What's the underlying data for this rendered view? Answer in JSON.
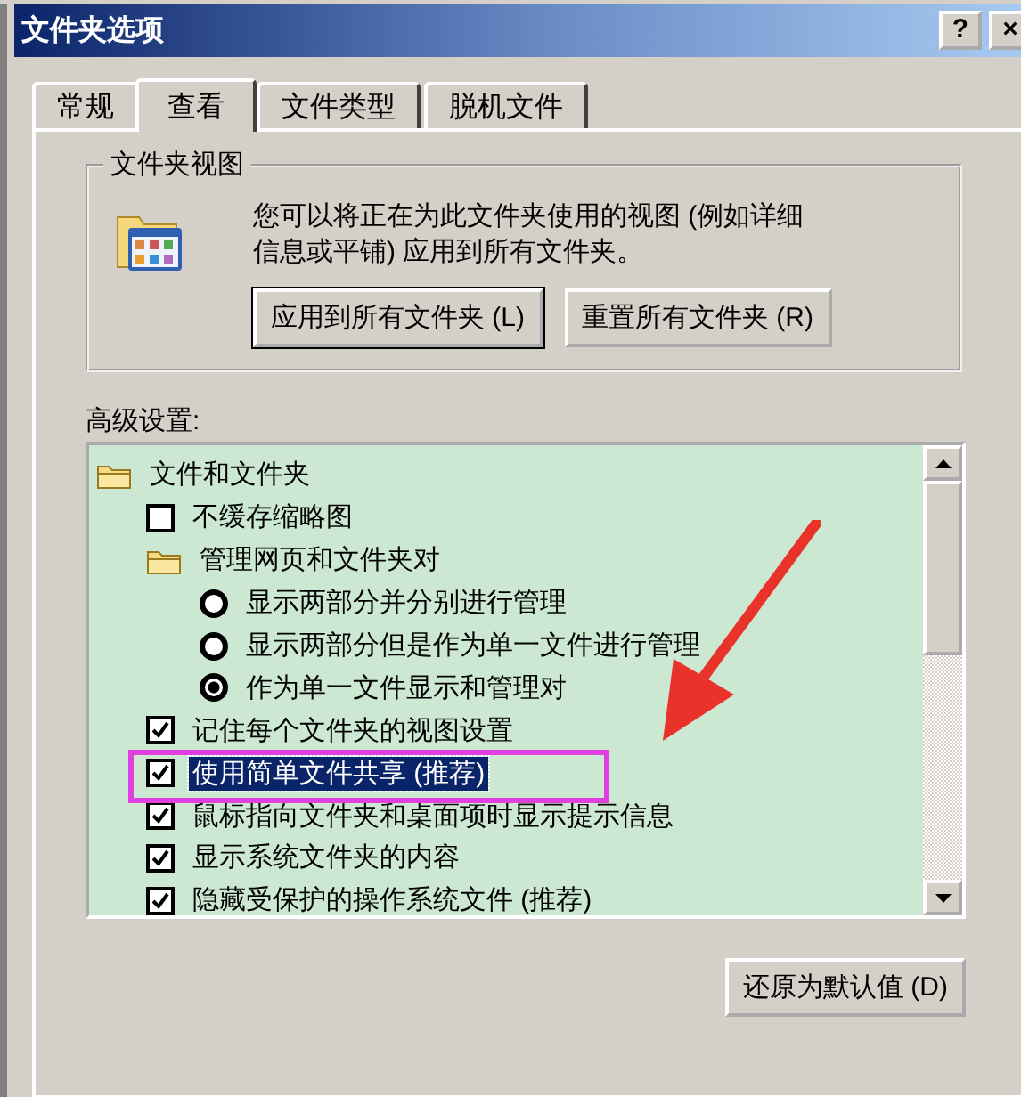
{
  "window": {
    "title": "文件夹选项",
    "buttons": [
      "?",
      "×"
    ]
  },
  "tabs": [
    {
      "label": "常规",
      "selected": false
    },
    {
      "label": "查看",
      "selected": true
    },
    {
      "label": "文件类型",
      "selected": false
    },
    {
      "label": "脱机文件",
      "selected": false
    }
  ],
  "folder_views": {
    "title": "文件夹视图",
    "description": "您可以将正在为此文件夹使用的视图 (例如详细信息或平铺) 应用到所有文件夹。",
    "buttons": [
      {
        "label": "应用到所有文件夹 (L)",
        "focused": true
      },
      {
        "label": "重置所有文件夹 (R)",
        "focused": false
      }
    ]
  },
  "advanced": {
    "label": "高级设置:",
    "items": [
      {
        "kind": "folder",
        "label": "文件和文件夹",
        "children": [
          {
            "kind": "checkbox",
            "label": "不缓存缩略图",
            "checked": false,
            "highlighted": false
          },
          {
            "kind": "folder",
            "label": "管理网页和文件夹对",
            "children": [
              {
                "kind": "radio",
                "label": "显示两部分并分别进行管理",
                "selected": false
              },
              {
                "kind": "radio",
                "label": "显示两部分但是作为单一文件进行管理",
                "selected": false
              },
              {
                "kind": "radio",
                "label": "作为单一文件显示和管理对",
                "selected": true
              }
            ]
          },
          {
            "kind": "checkbox",
            "label": "记住每个文件夹的视图设置",
            "checked": true,
            "highlighted": false
          },
          {
            "kind": "checkbox",
            "label": "使用简单文件共享 (推荐)",
            "checked": true,
            "highlighted": true
          },
          {
            "kind": "checkbox",
            "label": "鼠标指向文件夹和桌面项时显示提示信息",
            "checked": true,
            "highlighted": false
          },
          {
            "kind": "checkbox",
            "label": "显示系统文件夹的内容",
            "checked": true,
            "highlighted": false
          },
          {
            "kind": "checkbox",
            "label": "隐藏受保护的操作系统文件 (推荐)",
            "checked": true,
            "highlighted": false
          }
        ]
      }
    ]
  },
  "restore_button": "还原为默认值 (D)"
}
